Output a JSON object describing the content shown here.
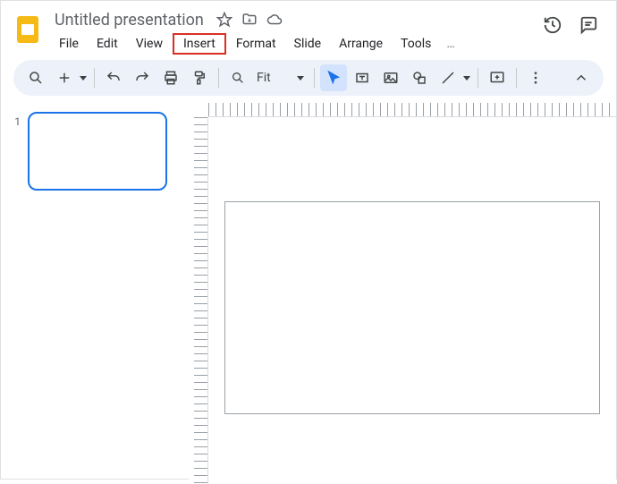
{
  "doc": {
    "title": "Untitled presentation"
  },
  "menus": {
    "file": "File",
    "edit": "Edit",
    "view": "View",
    "insert": "Insert",
    "format": "Format",
    "slide": "Slide",
    "arrange": "Arrange",
    "tools": "Tools",
    "more": "…"
  },
  "toolbar": {
    "zoom_label": "Fit"
  },
  "sidebar": {
    "thumbs": [
      {
        "number": "1"
      }
    ]
  }
}
